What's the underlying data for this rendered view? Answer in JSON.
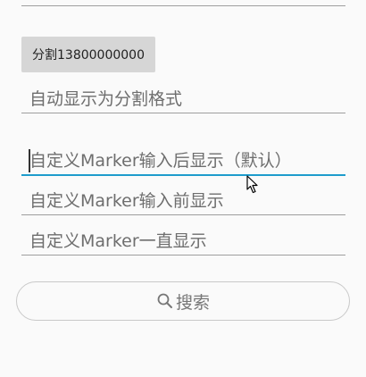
{
  "split_button_label": "分割13800000000",
  "fields": {
    "auto_split_hint": "自动显示为分割格式",
    "marker_after_hint": "自定义Marker输入后显示（默认）",
    "marker_before_hint": "自定义Marker输入前显示",
    "marker_always_hint": "自定义Marker一直显示"
  },
  "search_button_label": "搜索",
  "icons": {
    "search": "search-icon",
    "pointer": "mouse-pointer-icon"
  },
  "colors": {
    "focused_underline": "#1e9ccc",
    "underline": "#9e9e9e",
    "button_bg": "#d6d6d6"
  }
}
